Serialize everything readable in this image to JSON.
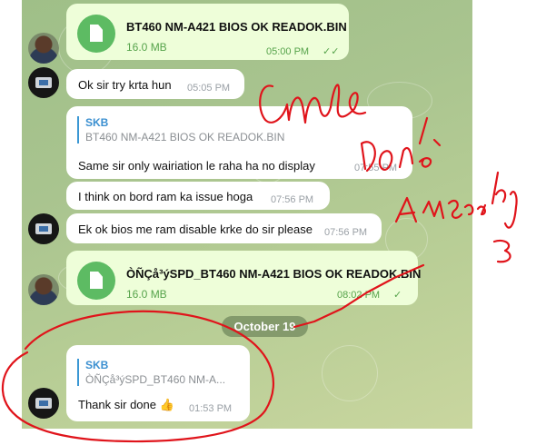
{
  "messages": [
    {
      "file_name": "BT460 NM-A421 BIOS OK READOK.BIN",
      "size": "16.0 MB",
      "time": "05:00 PM",
      "status": "✓✓"
    },
    {
      "text": "Ok sir try krta hun",
      "time": "05:05 PM"
    },
    {
      "reply_name": "SKB",
      "reply_text": "BT460 NM-A421 BIOS OK READOK.BIN",
      "text": "Same sir only wairiation le raha ha no display",
      "time": "07:55 PM"
    },
    {
      "text": "I think on bord ram ka issue hoga",
      "time": "07:56 PM"
    },
    {
      "text": "Ek ok bios me ram disable krke do sir please",
      "time": "07:56 PM"
    },
    {
      "file_name": "ÒÑÇå³ýSPD_BT460 NM-A421 BIOS OK READOK.BIN",
      "size": "16.0 MB",
      "time": "08:02 PM",
      "status": "✓"
    },
    {
      "reply_name": "SKB",
      "reply_text": "ÒÑÇå³ýSPD_BT460 NM-A...",
      "text": "Thank sir done",
      "emoji": "👍",
      "time": "01:53 PM"
    }
  ],
  "date_separator": "October 19",
  "annotation_color": "#e0141b"
}
